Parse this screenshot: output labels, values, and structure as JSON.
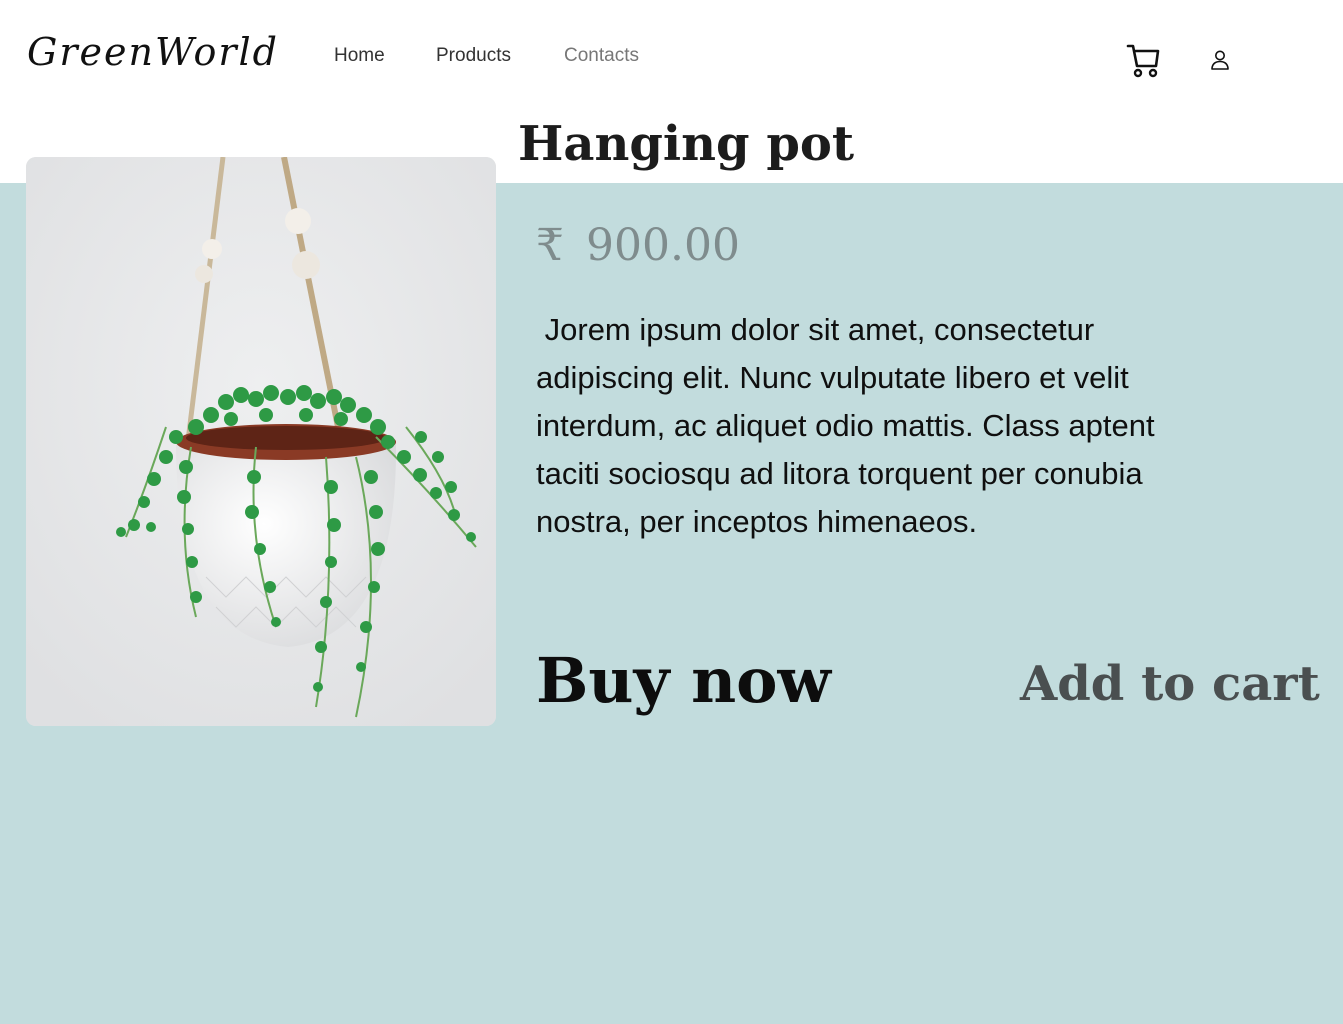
{
  "header": {
    "logo": "GreenWorld",
    "nav": {
      "home": "Home",
      "products": "Products",
      "contacts": "Contacts"
    },
    "icons": [
      "cart-icon",
      "user-icon"
    ]
  },
  "product": {
    "title": "Hanging pot",
    "currency_symbol": "₹",
    "price": "900.00",
    "description": " Jorem ipsum dolor sit amet, consectetur adipiscing elit. Nunc vulputate libero et velit interdum, ac aliquet odio mattis. Class aptent taciti sociosqu ad litora torquent per conubia nostra, per inceptos himenaeos.",
    "buy_now_label": "Buy now",
    "add_to_cart_label": "Add to cart"
  },
  "colors": {
    "band": "#c2dcdd",
    "price": "#7f8c8d",
    "text": "#0f0f0f"
  }
}
